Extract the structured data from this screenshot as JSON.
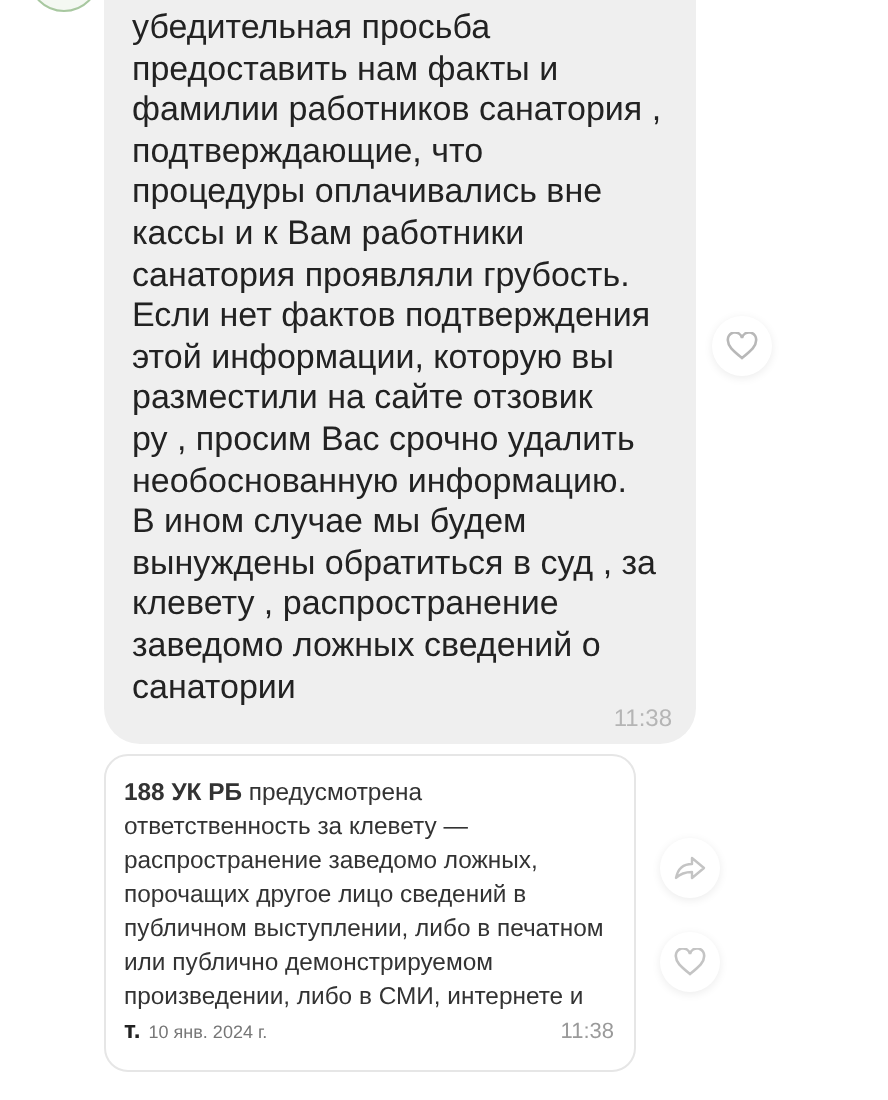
{
  "messages": [
    {
      "kind": "text",
      "text": "убедительная просьба\nпредоставить нам факты и\nфамилии работников санатория ,\nподтверждающие, что\nпроцедуры оплачивались вне\nкассы и к Вам работники\nсанатория проявляли грубость.\nЕсли нет фактов  подтверждения\nэтой информации, которую вы\nразместили на сайте отзовик\nру , просим Вас срочно удалить\nнеобоснованную информацию.\nВ ином случае мы будем\nвынуждены обратиться в суд , за\nклевету , распространение\nзаведомо ложных сведений о\nсанатории",
      "time": "11:38"
    },
    {
      "kind": "quote",
      "text": "**188 УК РБ** предусмотрена\nответственность за клевету —\nраспространение заведомо ложных,\nпорочащих другое лицо сведений в\nпубличном выступлении, либо в печатном\nили публично демонстрируемом\nпроизведении, либо в СМИ, интернете и",
      "tail": "т.",
      "date": "10 янв. 2024 г.",
      "time": "11:38"
    }
  ]
}
